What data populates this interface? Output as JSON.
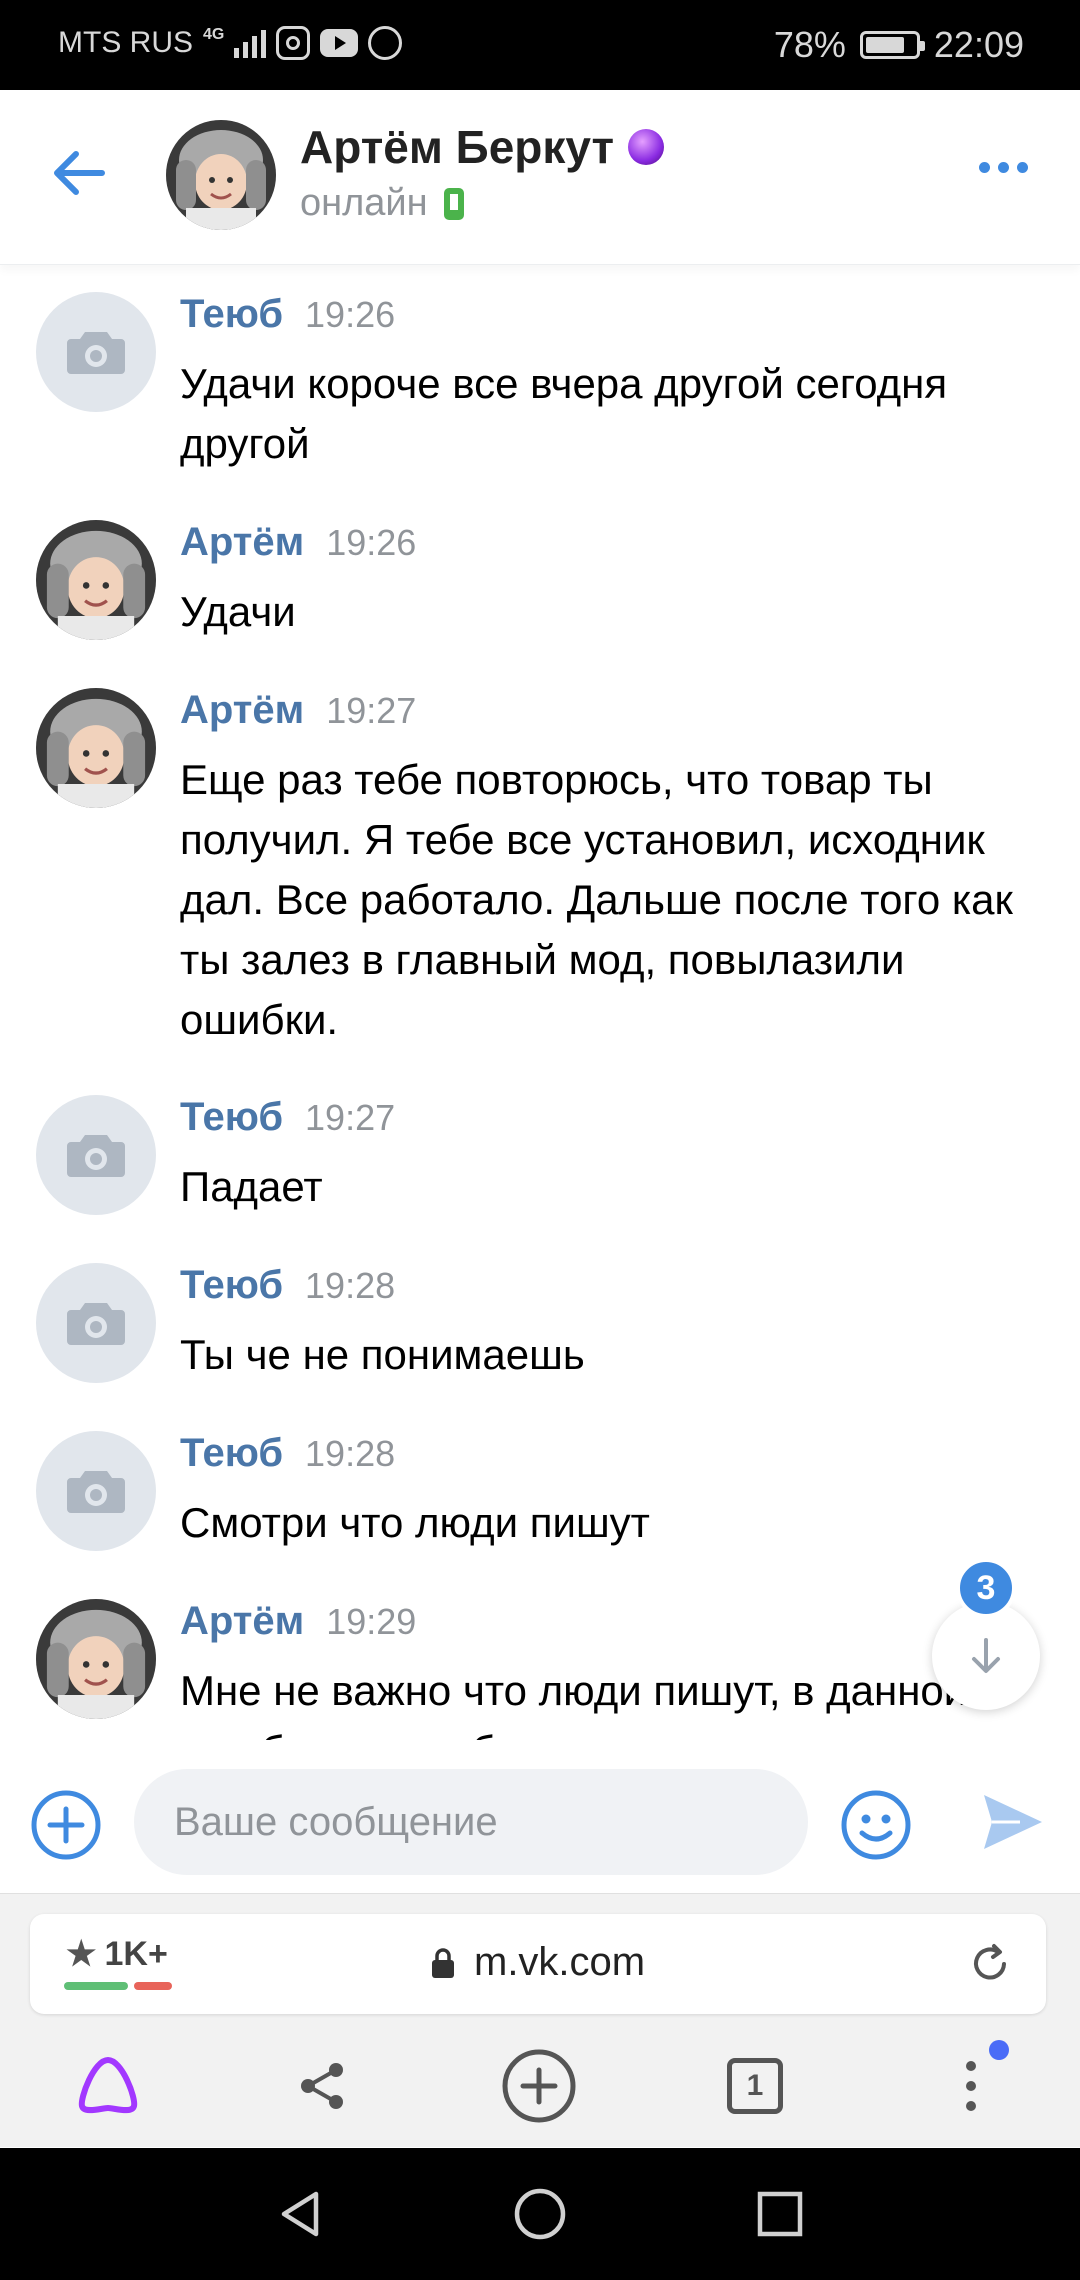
{
  "status_bar": {
    "carrier": "MTS RUS",
    "network": "4G",
    "battery": "78%",
    "time": "22:09",
    "app_icons": [
      "instagram-icon",
      "youtube-icon",
      "whatsapp-icon"
    ]
  },
  "header": {
    "contact_name": "Артём Беркут",
    "status": "онлайн",
    "back_icon": "arrow-left-icon",
    "badge_icon": "crystal-ball-icon",
    "more_icon": "more-dots-icon"
  },
  "messages": [
    {
      "author": "Теюб",
      "time": "19:26",
      "text": "Удачи короче все вчера другой сегодня другой",
      "avatar": "camera-placeholder"
    },
    {
      "author": "Артём",
      "time": "19:26",
      "text": "Удачи",
      "avatar": "photo"
    },
    {
      "author": "Артём",
      "time": "19:27",
      "text": "Еще раз тебе повторюсь, что товар ты получил. Я тебе все установил, исходник дал. Все работало. Дальше после того как ты залез в главный мод, повылазили ошибки.",
      "avatar": "photo"
    },
    {
      "author": "Теюб",
      "time": "19:27",
      "text": "Падает",
      "avatar": "camera-placeholder"
    },
    {
      "author": "Теюб",
      "time": "19:28",
      "text": "Ты че не понимаешь",
      "avatar": "camera-placeholder"
    },
    {
      "author": "Теюб",
      "time": "19:28",
      "text": "Смотри что люди пишут",
      "avatar": "camera-placeholder"
    },
    {
      "author": "Артём",
      "time": "19:29",
      "text": "Мне не важно что люди пишут, в данной ошибке может быть как твоя вина так и",
      "avatar": "photo"
    }
  ],
  "scroll_down": {
    "unread_count": "3"
  },
  "composer": {
    "placeholder": "Ваше сообщение"
  },
  "browser": {
    "rating": "1K+",
    "url": "m.vk.com",
    "tabs_count": "1"
  },
  "colors": {
    "accent": "#3f8ae0",
    "author": "#4a76a8",
    "online": "#4bb34b",
    "alice": "#a238ff"
  }
}
